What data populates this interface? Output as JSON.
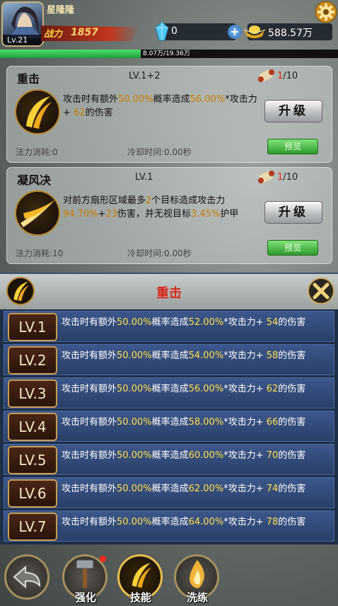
{
  "player": {
    "name": "星隆隆",
    "level": "Lv.21",
    "power_label": "战力",
    "power": "1857"
  },
  "resources": {
    "gems": "0",
    "gold": "588.57万"
  },
  "exp": {
    "text": "8.07万/19.36万",
    "progress": 0.417
  },
  "cards": [
    {
      "name": "重击",
      "level": "LV.1+2",
      "count_cur": "1",
      "count_max": "/10",
      "desc": [
        {
          "t": "攻击时有额外"
        },
        {
          "t": "50.00%",
          "h": 1
        },
        {
          "t": "概率造成"
        },
        {
          "t": "56.00%",
          "h": 1
        },
        {
          "t": "*攻击力+ "
        },
        {
          "t": "62",
          "h": 1
        },
        {
          "t": "的伤害"
        }
      ],
      "upgrade": "升级",
      "preview": "预览",
      "mana": "法力消耗:0",
      "cooldown": "冷却时间:0.00秒"
    },
    {
      "name": "凝风决",
      "level": "LV.1",
      "count_cur": "1",
      "count_max": "/10",
      "desc": [
        {
          "t": "对前方扇形区域最多"
        },
        {
          "t": "2",
          "h": 1
        },
        {
          "t": "个目标造成攻击力"
        },
        {
          "t": "94.70%",
          "h": 1
        },
        {
          "t": "+"
        },
        {
          "t": "23",
          "h": 1
        },
        {
          "t": "伤害，并无视目标"
        },
        {
          "t": "3.45%",
          "h": 1
        },
        {
          "t": "护甲"
        }
      ],
      "upgrade": "升级",
      "preview": "预览",
      "mana": "法力消耗:10",
      "cooldown": "冷却时间:0.00秒"
    }
  ],
  "panel": {
    "title": "重击",
    "rows": [
      {
        "lv": "LV.1",
        "prob": "50.00%",
        "pct": "52.00%",
        "add": "54"
      },
      {
        "lv": "LV.2",
        "prob": "50.00%",
        "pct": "54.00%",
        "add": "58"
      },
      {
        "lv": "LV.3",
        "prob": "50.00%",
        "pct": "56.00%",
        "add": "62"
      },
      {
        "lv": "LV.4",
        "prob": "50.00%",
        "pct": "58.00%",
        "add": "66"
      },
      {
        "lv": "LV.5",
        "prob": "50.00%",
        "pct": "60.00%",
        "add": "70"
      },
      {
        "lv": "LV.6",
        "prob": "50.00%",
        "pct": "62.00%",
        "add": "74"
      },
      {
        "lv": "LV.7",
        "prob": "50.00%",
        "pct": "64.00%",
        "add": "78"
      }
    ],
    "row_text": {
      "a": "攻击时有额外",
      "b": "概率造成",
      "c": "*攻击力+ ",
      "d": "的伤害"
    }
  },
  "nav": [
    {
      "label": "",
      "name": "back"
    },
    {
      "label": "强化",
      "name": "strengthen"
    },
    {
      "label": "技能",
      "name": "skills"
    },
    {
      "label": "洗练",
      "name": "refine"
    }
  ],
  "colors": {
    "highlight": "#ffe14a",
    "accent_red": "#d8281c",
    "exp_green": "#2ebd4a"
  }
}
